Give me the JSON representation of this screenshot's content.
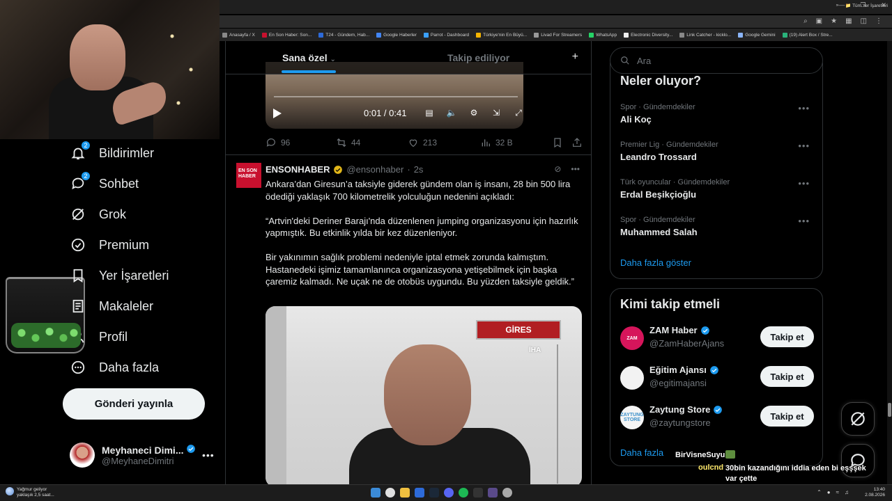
{
  "browser": {
    "bookmarks": [
      "Anasayfa / X",
      "En Son Haber: Son...",
      "T24 - Gündem, Hab...",
      "Google Haberler",
      "Parrot - Dashboard",
      "Türkiye'nin En Büyü...",
      "Livad For Streamers",
      "WhatsApp",
      "Electronic Diversity...",
      "Link Catcher - kicklo...",
      "Google Gemini",
      "(19) Alert Box / Stre..."
    ],
    "bookmarks_more": "»",
    "all_bookmarks": "Tüm Yer İşaretleri"
  },
  "nav": {
    "items": [
      {
        "label": "Bildirimler",
        "icon": "bell-icon",
        "badge": "2"
      },
      {
        "label": "Sohbet",
        "icon": "chat-icon",
        "badge": "2"
      },
      {
        "label": "Grok",
        "icon": "grok-icon"
      },
      {
        "label": "Premium",
        "icon": "verified-icon"
      },
      {
        "label": "Yer İşaretleri",
        "icon": "bookmark-icon"
      },
      {
        "label": "Makaleler",
        "icon": "article-icon"
      },
      {
        "label": "Profil",
        "icon": "person-icon"
      },
      {
        "label": "Daha fazla",
        "icon": "more-circle-icon"
      }
    ],
    "post_button": "Gönderi yayınla",
    "profile": {
      "name": "Meyhaneci Dimi...",
      "handle": "@MeyhaneDimitri",
      "more": "•••"
    }
  },
  "feed": {
    "tabs": {
      "active": "Sana özel",
      "inactive": "Takip ediliyor",
      "add": "+"
    },
    "video": {
      "time": "0:01 / 0:41"
    },
    "prev_actions": {
      "replies": "96",
      "reposts": "44",
      "likes": "213",
      "views": "32 B"
    },
    "tweet": {
      "name": "ENSONHABER",
      "handle": "@ensonhaber",
      "dot": "·",
      "time": "2s",
      "avatar_text": "EN SON HABER",
      "paragraphs": [
        "Ankara’dan Giresun’a taksiyle giderek gündem olan iş insanı, 28 bin 500 lira ödediği yaklaşık 700 kilometrelik yolculuğun nedenini açıkladı:",
        "“Artvin'deki Deriner Barajı'nda düzenlenen jumping organizasyonu için hazırlık yapmıştık. Bu etkinlik yılda bir kez düzenleniyor.",
        "Bir yakınımın sağlık problemi nedeniyle iptal etmek zorunda kalmıştım. Hastanedeki işimiz tamamlanınca organizasyona yetişebilmek için başka çaremiz kalmadı. Ne uçak ne de otobüs uygundu. Bu yüzden taksiyle geldik.”"
      ],
      "media_tag": "GİRES",
      "media_watermark": "İHA"
    }
  },
  "sidebar": {
    "search_placeholder": "Ara",
    "trends_title": "Neler oluyor?",
    "trends": [
      {
        "meta": "Spor · Gündemdekiler",
        "name": "Ali Koç"
      },
      {
        "meta": "Premier Lig · Gündemdekiler",
        "name": "Leandro Trossard"
      },
      {
        "meta": "Türk oyuncular · Gündemdekiler",
        "name": "Erdal Beşikçioğlu"
      },
      {
        "meta": "Spor · Gündemdekiler",
        "name": "Muhammed Salah"
      }
    ],
    "trends_show_more": "Daha fazla göster",
    "who_title": "Kimi takip etmeli",
    "who": [
      {
        "name": "ZAM Haber",
        "handle": "@ZamHaberAjans",
        "button": "Takip et",
        "avatar_color": "#d6155b",
        "avatar_text": "ZAM"
      },
      {
        "name": "Eğitim Ajansı",
        "handle": "@egitimajansi",
        "button": "Takip et",
        "avatar_color": "#f2f2f2",
        "avatar_text": ""
      },
      {
        "name": "Zaytung Store",
        "handle": "@zaytungstore",
        "button": "Takip et",
        "avatar_color": "#f5f5f5",
        "avatar_text": "ZAYTUNG STORE"
      }
    ],
    "who_show_more": "Daha fazla"
  },
  "chat": {
    "user1": "BirVisneSuyu",
    "user2": "oulcnd",
    "message2": "30bin kazandığını iddia eden bi eşşşek var çette"
  },
  "taskbar": {
    "weather_title": "Yağmur geliyor",
    "weather_sub": "yaklaşık 2,5 saat...",
    "time": "13:40",
    "date": "2.08.2026"
  },
  "colors": {
    "accent": "#1d9bf0",
    "gold_badge": "#e2b719",
    "red_brand": "#c8102e"
  }
}
